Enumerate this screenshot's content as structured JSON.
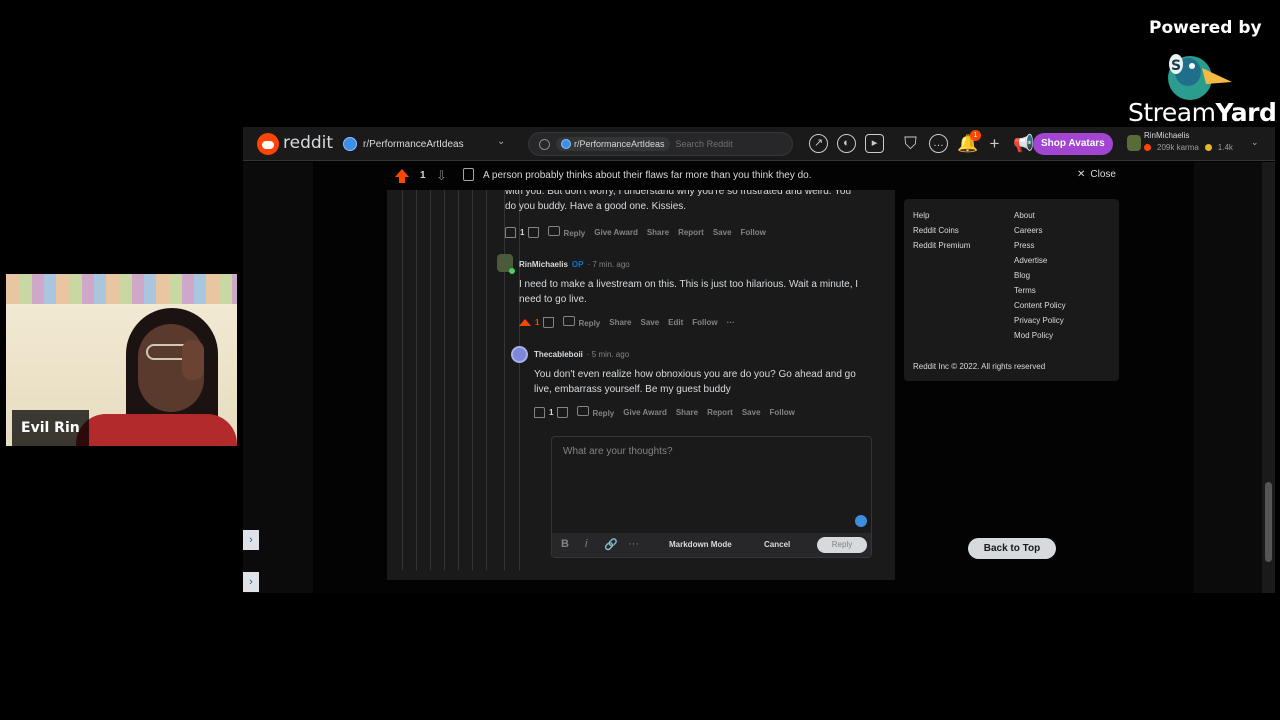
{
  "streamyard": {
    "powered_by": "Powered by",
    "brand_stream": "Stream",
    "brand_yard": "Yard"
  },
  "webcam": {
    "name": "Evil Rin"
  },
  "reddit": {
    "logo_text": "reddit",
    "subreddit": "r/PerformanceArtIdeas",
    "search": {
      "scope": "r/PerformanceArtIdeas",
      "placeholder": "Search Reddit"
    },
    "notifications_count": "1",
    "shop_label": "Shop Avatars",
    "user": {
      "name": "RinMichaelis",
      "karma": "209k karma",
      "coins": "1.4k"
    }
  },
  "post_bar": {
    "vote_count": "1",
    "title": "A person probably thinks about their flaws far more than you think they do.",
    "close_label": "Close"
  },
  "comments": [
    {
      "text_line1": "with you. But don't worry, I understand why you're so frustrated and weird. You",
      "text_line2": "do you buddy. Have a good one. Kissies.",
      "votes": "1",
      "actions": [
        "Reply",
        "Give Award",
        "Share",
        "Report",
        "Save",
        "Follow"
      ]
    },
    {
      "author": "RinMichaelis",
      "op": "OP",
      "time": "· 7 min. ago",
      "text_line1": "I need to make a livestream on this. This is just too hilarious. Wait a minute, I",
      "text_line2": "need to go live.",
      "votes": "1",
      "actions": [
        "Reply",
        "Share",
        "Save",
        "Edit",
        "Follow",
        "···"
      ]
    },
    {
      "author": "Thecableboii",
      "time": "· 5 min. ago",
      "text_line1": "You don't even realize how obnoxious you are do you? Go ahead and go",
      "text_line2": "live, embarrass yourself. Be my guest buddy",
      "votes": "1",
      "actions": [
        "Reply",
        "Give Award",
        "Share",
        "Report",
        "Save",
        "Follow"
      ]
    }
  ],
  "editor": {
    "placeholder": "What are your thoughts?",
    "bold": "B",
    "italic": "i",
    "more": "···",
    "markdown_mode": "Markdown Mode",
    "cancel": "Cancel",
    "reply": "Reply"
  },
  "footer": {
    "col1": [
      "Help",
      "Reddit Coins",
      "Reddit Premium"
    ],
    "col2": [
      "About",
      "Careers",
      "Press",
      "Advertise",
      "Blog",
      "Terms",
      "Content Policy",
      "Privacy Policy",
      "Mod Policy"
    ],
    "copyright": "Reddit Inc © 2022. All rights reserved"
  },
  "back_to_top": "Back to Top",
  "colors": {
    "reddit_orange": "#ff4500",
    "shop_purple": "#a245d3",
    "op_blue": "#0079d3"
  }
}
